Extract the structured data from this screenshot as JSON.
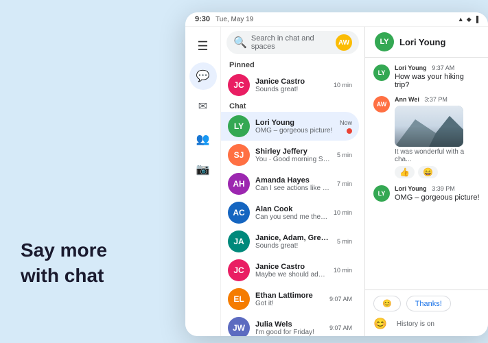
{
  "tagline": {
    "line1": "Say more",
    "line2": "with chat"
  },
  "status_bar": {
    "time": "9:30",
    "date": "Tue, May 19"
  },
  "search": {
    "placeholder": "Search in chat and spaces"
  },
  "sections": {
    "pinned": "Pinned",
    "chat": "Chat"
  },
  "chat_items": [
    {
      "name": "Janice Castro",
      "preview": "Sounds great!",
      "time": "10 min",
      "color": "#e91e63",
      "initials": "JC",
      "active": false,
      "dot": false
    },
    {
      "name": "Lori Young",
      "preview": "OMG – gorgeous picture!",
      "time": "Now",
      "color": "#34a853",
      "initials": "LY",
      "active": true,
      "dot": true
    },
    {
      "name": "Shirley Jeffery",
      "preview": "You · Good morning Shirley and Jeff...",
      "time": "5 min",
      "color": "#ff7043",
      "initials": "SJ",
      "active": false,
      "dot": false
    },
    {
      "name": "Amanda Hayes",
      "preview": "Can I see actions like unread?",
      "time": "7 min",
      "color": "#9c27b0",
      "initials": "AH",
      "active": false,
      "dot": false
    },
    {
      "name": "Alan Cook",
      "preview": "Can you send me the file?",
      "time": "10 min",
      "color": "#1565c0",
      "initials": "AC",
      "active": false,
      "dot": false
    },
    {
      "name": "Janice, Adam, Gregory",
      "preview": "Sounds great!",
      "time": "5 min",
      "color": "#00897b",
      "initials": "JA",
      "active": false,
      "dot": false
    },
    {
      "name": "Janice Castro",
      "preview": "Maybe we should add Gloria to the...",
      "time": "10 min",
      "color": "#e91e63",
      "initials": "JC",
      "active": false,
      "dot": false
    },
    {
      "name": "Ethan Lattimore",
      "preview": "Got it!",
      "time": "9:07 AM",
      "color": "#f57c00",
      "initials": "EL",
      "active": false,
      "dot": false
    },
    {
      "name": "Julia Wels",
      "preview": "I'm good for Friday!",
      "time": "9:07 AM",
      "color": "#5c6bc0",
      "initials": "JW",
      "active": false,
      "dot": false
    }
  ],
  "conversation": {
    "contact_name": "Lori Young",
    "contact_initials": "LY",
    "contact_color": "#34a853",
    "messages": [
      {
        "sender": "Lori Young",
        "time": "9:37 AM",
        "text": "How was your hiking trip?",
        "avatar_color": "#34a853",
        "initials": "LY",
        "has_image": false
      },
      {
        "sender": "Ann Wei",
        "time": "3:37 PM",
        "text": "",
        "avatar_color": "#ff7043",
        "initials": "AW",
        "has_image": true,
        "image_caption": "It was wonderful with a cha..."
      },
      {
        "sender": "Lori Young",
        "time": "3:39 PM",
        "text": "OMG – gorgeous picture!",
        "avatar_color": "#34a853",
        "initials": "LY",
        "has_image": false
      }
    ],
    "reactions": [
      "👍",
      "😄"
    ],
    "quick_replies": [
      "😊",
      "Thanks!"
    ],
    "footer_emoji": "😊",
    "history_label": "History is on"
  }
}
